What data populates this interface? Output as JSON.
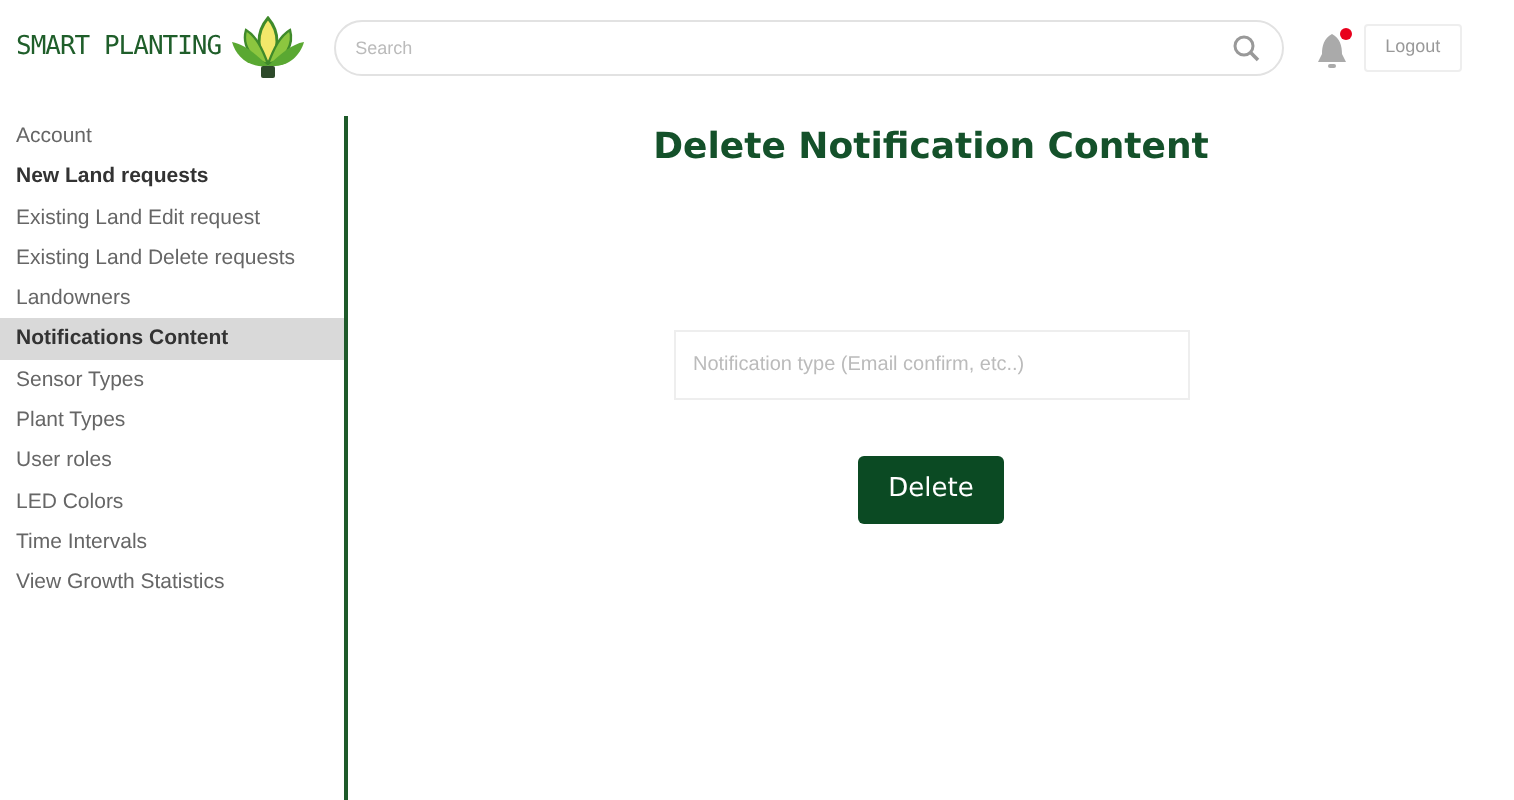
{
  "header": {
    "logo_text": "SMART PLANTING",
    "search": {
      "placeholder": "Search"
    },
    "notification_unread": true,
    "logout": "Logout"
  },
  "sidebar": {
    "items": [
      {
        "label": "Account",
        "selected": false,
        "bold": false
      },
      {
        "label": "New Land requests",
        "selected": false,
        "bold": true
      },
      {
        "label": "Existing Land Edit request",
        "selected": false,
        "bold": false
      },
      {
        "label": "Existing Land Delete requests",
        "selected": false,
        "bold": false
      },
      {
        "label": "Landowners",
        "selected": false,
        "bold": false
      },
      {
        "label": "Notifications Content",
        "selected": true,
        "bold": true
      },
      {
        "label": "Sensor Types",
        "selected": false,
        "bold": false
      },
      {
        "label": "Plant Types",
        "selected": false,
        "bold": false
      },
      {
        "label": "User roles",
        "selected": false,
        "bold": false
      },
      {
        "label": "LED Colors",
        "selected": false,
        "bold": false
      },
      {
        "label": "Time Intervals",
        "selected": false,
        "bold": false
      },
      {
        "label": "View Growth Statistics",
        "selected": false,
        "bold": false
      }
    ]
  },
  "main": {
    "title": "Delete Notification Content",
    "field": {
      "placeholder": "Notification type (Email confirm, etc..)"
    },
    "button": "Delete"
  }
}
